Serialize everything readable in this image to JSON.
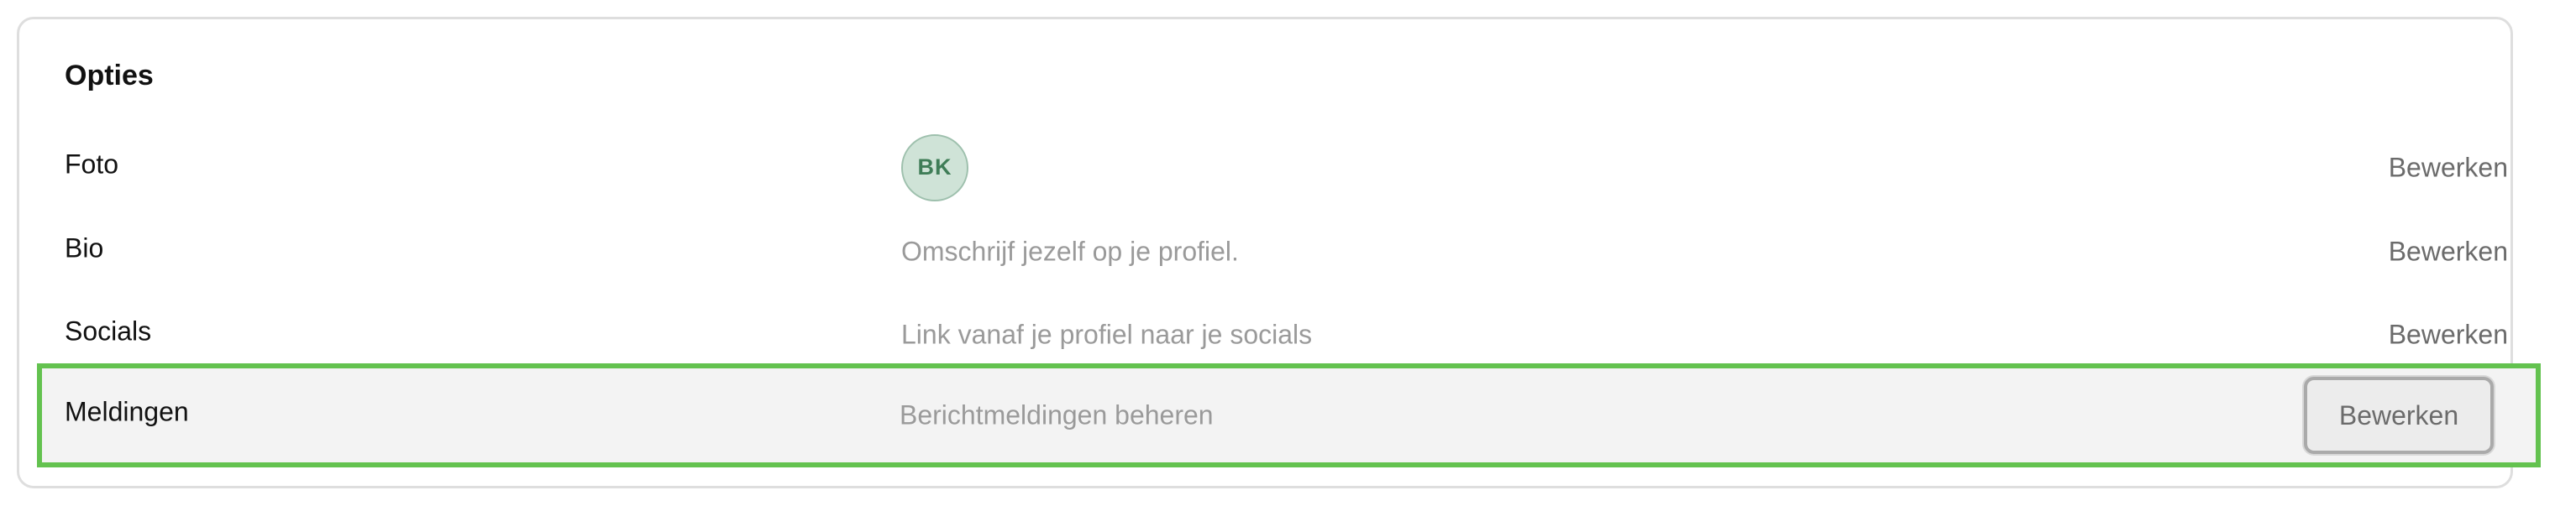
{
  "section": {
    "title": "Opties"
  },
  "rows": [
    {
      "label": "Foto",
      "value": "",
      "avatar_initials": "BK",
      "action": "Bewerken"
    },
    {
      "label": "Bio",
      "value": "Omschrijf jezelf op je profiel.",
      "action": "Bewerken"
    },
    {
      "label": "Socials",
      "value": "Link vanaf je profiel naar je socials",
      "action": "Bewerken"
    },
    {
      "label": "Meldingen",
      "value": "Berichtmeldingen beheren",
      "action": "Bewerken"
    }
  ],
  "colors": {
    "highlight_border": "#63c24f",
    "avatar_bg": "#cfe3d7",
    "avatar_text": "#3f7d57"
  }
}
